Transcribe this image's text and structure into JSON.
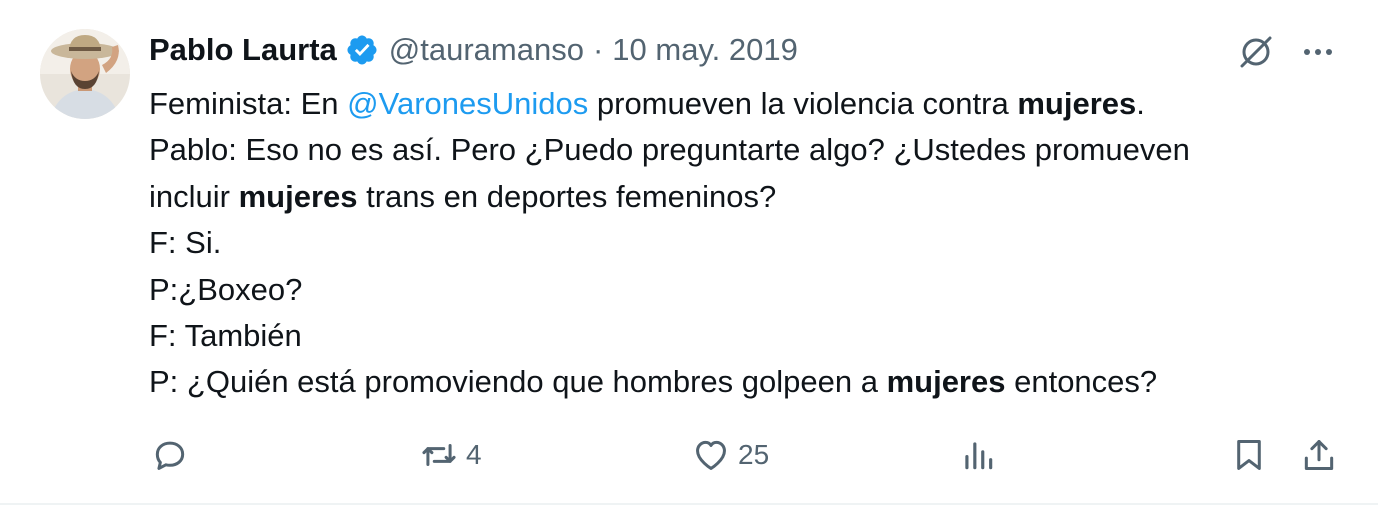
{
  "tweet": {
    "author_name": "Pablo Laurta",
    "handle": "@tauramanso",
    "separator": "·",
    "date": "10 may. 2019",
    "body": {
      "line1_a": "Feminista: En ",
      "line1_mention": "@VaronesUnidos",
      "line1_b": " promueven la violencia contra ",
      "line1_bold": "mujeres",
      "line1_c": ".",
      "line2": "Pablo: Eso no es así. Pero ¿Puedo preguntarte algo? ¿Ustedes promueven",
      "line3_a": "incluir ",
      "line3_bold": "mujeres",
      "line3_b": " trans en deportes femeninos?",
      "line4": "F: Si.",
      "line5": "P:¿Boxeo?",
      "line6": "F: También",
      "line7_a": "P: ¿Quién está promoviendo que hombres golpeen a ",
      "line7_bold": "mujeres",
      "line7_b": " entonces?"
    }
  },
  "actions": {
    "reply_count": "",
    "retweet_count": "4",
    "like_count": "25",
    "views_count": ""
  },
  "icons": {
    "verified": "verified-badge-icon",
    "grok": "grok-icon",
    "more": "more-icon",
    "reply": "reply-icon",
    "retweet": "retweet-icon",
    "like": "heart-icon",
    "views": "views-icon",
    "bookmark": "bookmark-icon",
    "share": "share-icon"
  },
  "colors": {
    "text": "#0f1419",
    "secondary": "#536471",
    "accent": "#1d9bf0"
  }
}
